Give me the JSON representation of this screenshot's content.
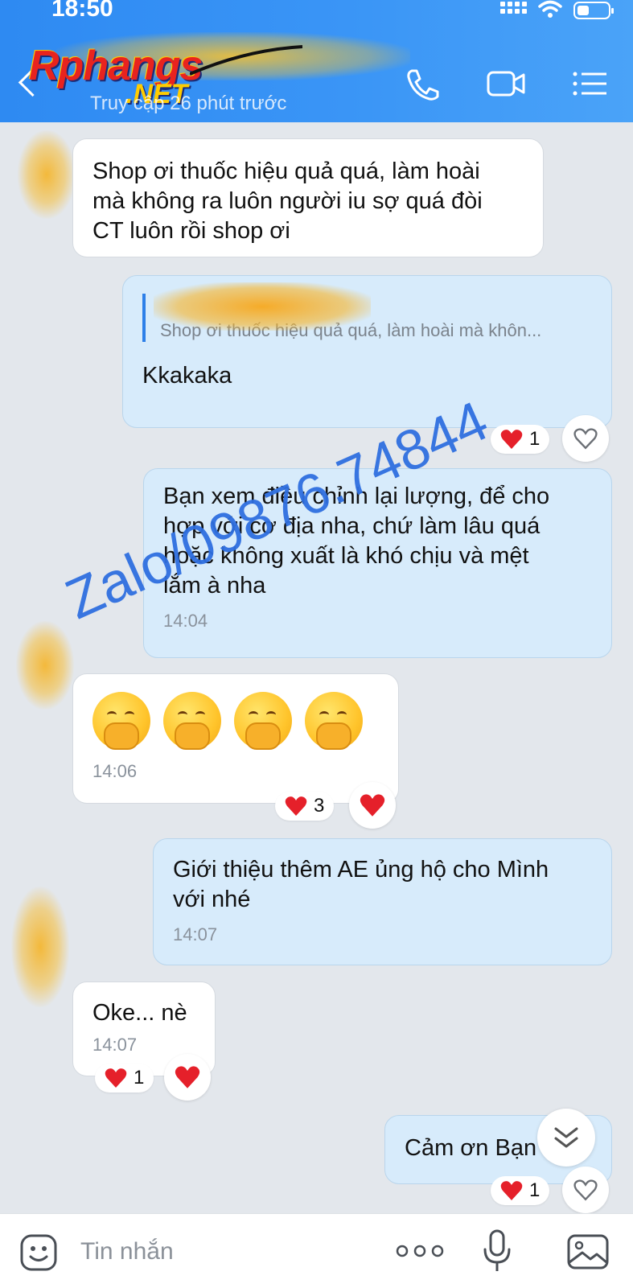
{
  "status_bar": {
    "time": "18:50"
  },
  "header": {
    "subtitle": "Truy cập 26 phút trước",
    "logo_text": "Rphangs",
    "logo_sub": ".NET",
    "accent_color": "#3a95f6"
  },
  "watermark": {
    "text": "Zalo/09876.74844"
  },
  "messages": [
    {
      "direction": "in",
      "text": "Shop ơi thuốc hiệu quả quá, làm hoài\nmà không ra luôn người iu sợ quá đòi\nCT luôn rồi shop ơi"
    },
    {
      "direction": "out",
      "quote_text": "Shop ơi thuốc hiệu quả quá, làm hoài mà khôn...",
      "text": "Kkakaka",
      "reaction_count": "1"
    },
    {
      "direction": "out",
      "text": "Bạn xem điều chỉnh lại lượng, để cho\nhợp với cơ địa nha, chứ làm lâu quá\nhoặc không xuất là khó chịu và mệt\nlắm à nha",
      "time": "14:04"
    },
    {
      "direction": "in",
      "time": "14:06",
      "reaction_count": "3"
    },
    {
      "direction": "out",
      "text": "Giới thiệu thêm AE ủng hộ cho Mình\nvới nhé",
      "time": "14:07"
    },
    {
      "direction": "in",
      "text": "Oke... nè",
      "time": "14:07",
      "reaction_count": "1"
    },
    {
      "direction": "out",
      "text": "Cảm ơn Bạn",
      "reaction_count": "1"
    }
  ],
  "input": {
    "placeholder": "Tin nhắn"
  }
}
